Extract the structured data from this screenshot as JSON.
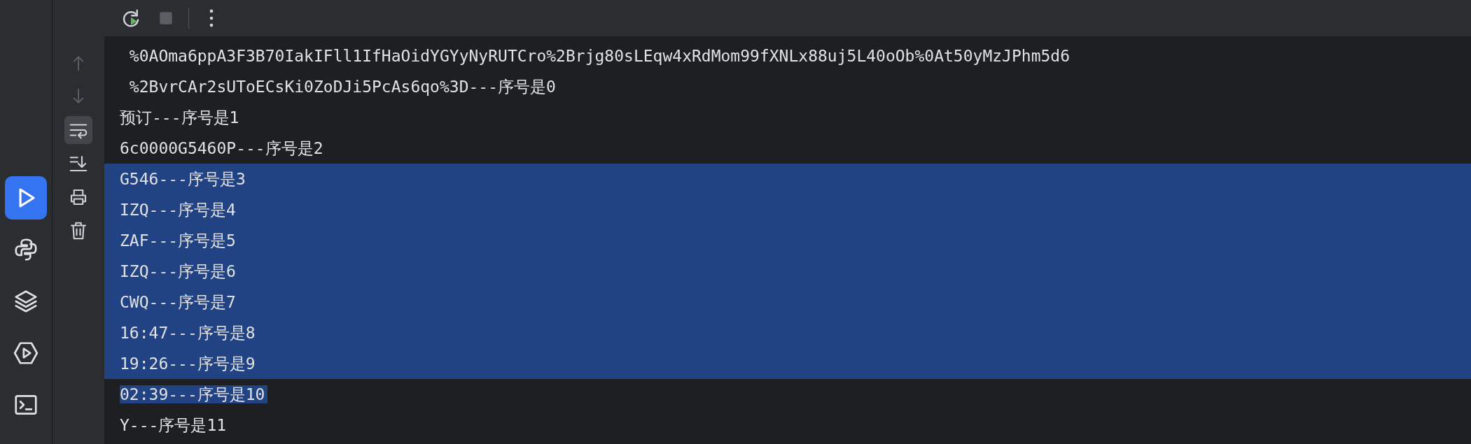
{
  "sidebar": {
    "items": [
      {
        "selected": true
      },
      {
        "selected": false
      },
      {
        "selected": false
      },
      {
        "selected": false
      },
      {
        "selected": false
      }
    ]
  },
  "console_tools": [
    {
      "selected": false,
      "disabled": true
    },
    {
      "selected": false,
      "disabled": true
    },
    {
      "selected": true,
      "disabled": false
    },
    {
      "selected": false,
      "disabled": false
    },
    {
      "selected": false,
      "disabled": false
    },
    {
      "selected": false,
      "disabled": false
    }
  ],
  "console": {
    "lines": [
      {
        "text": " %0AOma6ppA3F3B70IakIFll1IfHaOidYGYyNyRUTCro%2Brjg80sLEqw4xRdMom99fXNLx88uj5L40oOb%0At50yMzJPhm5d6",
        "selected": false
      },
      {
        "text": " %2BvrCAr2sUToECsKi0ZoDJi5PcAs6qo%3D---序号是0",
        "selected": false
      },
      {
        "text": "预订---序号是1",
        "selected": false
      },
      {
        "text": "6c0000G5460P---序号是2",
        "selected": false
      },
      {
        "text": "G546---序号是3",
        "selected": true
      },
      {
        "text": "IZQ---序号是4",
        "selected": true
      },
      {
        "text": "ZAF---序号是5",
        "selected": true
      },
      {
        "text": "IZQ---序号是6",
        "selected": true
      },
      {
        "text": "CWQ---序号是7",
        "selected": true
      },
      {
        "text": "16:47---序号是8",
        "selected": true
      },
      {
        "text": "19:26---序号是9",
        "selected": true
      },
      {
        "text": "02:39---序号是10",
        "selected": true
      },
      {
        "text": "Y---序号是11",
        "selected": false
      }
    ]
  }
}
